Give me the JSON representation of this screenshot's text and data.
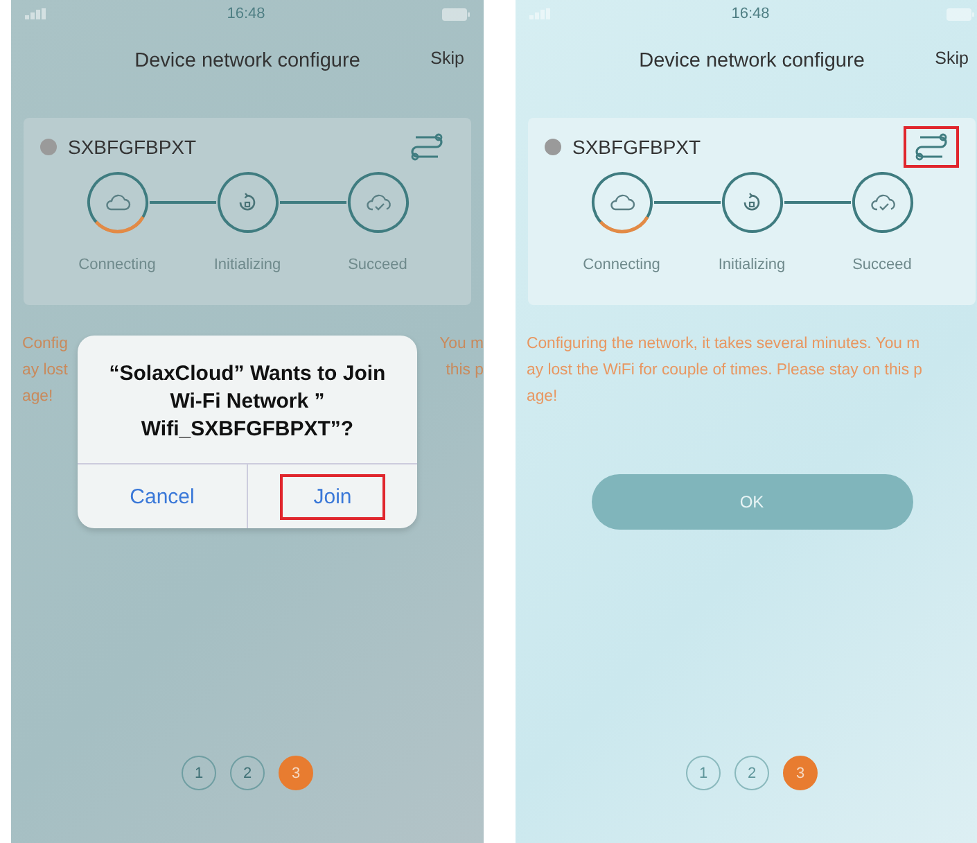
{
  "screens": [
    {
      "status_bar": {
        "time": "16:48"
      },
      "title": "Device network configure",
      "skip": "Skip",
      "device": {
        "name": "SXBFGFBPXT",
        "settings_highlighted": false
      },
      "steps": [
        {
          "label": "Connecting",
          "active": true
        },
        {
          "label": "Initializing",
          "active": false
        },
        {
          "label": "Succeed",
          "active": false
        }
      ],
      "message_lines": [
        [
          "Config",
          "You m"
        ],
        [
          "ay lost",
          "this p"
        ],
        [
          "age!"
        ]
      ],
      "dialog": {
        "message": "“SolaxCloud” Wants to Join Wi-Fi Network ” Wifi_SXBFGFBPXT”?",
        "buttons": [
          {
            "label": "Cancel",
            "highlighted": false
          },
          {
            "label": "Join",
            "highlighted": true
          }
        ]
      },
      "pages": [
        {
          "label": "1",
          "selected": false
        },
        {
          "label": "2",
          "selected": false
        },
        {
          "label": "3",
          "selected": true
        }
      ]
    },
    {
      "status_bar": {
        "time": "16:48"
      },
      "title": "Device network configure",
      "skip": "Skip",
      "device": {
        "name": "SXBFGFBPXT",
        "settings_highlighted": true
      },
      "steps": [
        {
          "label": "Connecting",
          "active": true
        },
        {
          "label": "Initializing",
          "active": false
        },
        {
          "label": "Succeed",
          "active": false
        }
      ],
      "message_lines": [
        [
          "Configuring the network, it takes several minutes. You m"
        ],
        [
          "ay lost the WiFi for couple of times. Please stay on this p"
        ],
        [
          "age!"
        ]
      ],
      "ok_button": "OK",
      "pages": [
        {
          "label": "1",
          "selected": false
        },
        {
          "label": "2",
          "selected": false
        },
        {
          "label": "3",
          "selected": true
        }
      ]
    }
  ]
}
